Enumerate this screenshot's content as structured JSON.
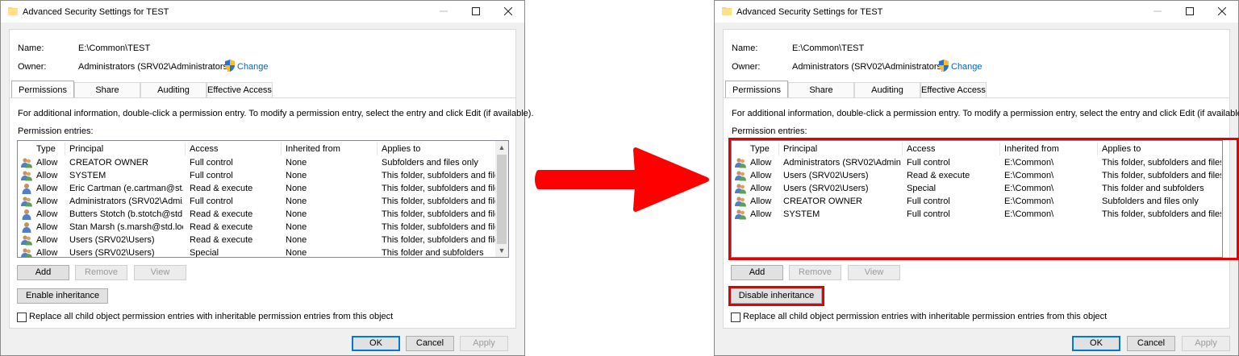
{
  "left": {
    "title": "Advanced Security Settings for TEST",
    "name_label": "Name:",
    "name_value": "E:\\Common\\TEST",
    "owner_label": "Owner:",
    "owner_value": "Administrators (SRV02\\Administrators)",
    "change_link": "Change",
    "tabs": [
      "Permissions",
      "Share",
      "Auditing",
      "Effective Access"
    ],
    "info": "For additional information, double-click a permission entry. To modify a permission entry, select the entry and click Edit (if available).",
    "entries_label": "Permission entries:",
    "columns": [
      "Type",
      "Principal",
      "Access",
      "Inherited from",
      "Applies to"
    ],
    "rows": [
      {
        "icon": "group-icon",
        "type": "Allow",
        "principal": "CREATOR OWNER",
        "access": "Full control",
        "inherited": "None",
        "applies": "Subfolders and files only"
      },
      {
        "icon": "group-icon",
        "type": "Allow",
        "principal": "SYSTEM",
        "access": "Full control",
        "inherited": "None",
        "applies": "This folder, subfolders and files"
      },
      {
        "icon": "user-icon",
        "type": "Allow",
        "principal": "Eric Cartman (e.cartman@st...",
        "access": "Read & execute",
        "inherited": "None",
        "applies": "This folder, subfolders and files"
      },
      {
        "icon": "group-icon",
        "type": "Allow",
        "principal": "Administrators (SRV02\\Admi...",
        "access": "Full control",
        "inherited": "None",
        "applies": "This folder, subfolders and files"
      },
      {
        "icon": "user-icon",
        "type": "Allow",
        "principal": "Butters Stotch (b.stotch@std....",
        "access": "Read & execute",
        "inherited": "None",
        "applies": "This folder, subfolders and files"
      },
      {
        "icon": "user-icon",
        "type": "Allow",
        "principal": "Stan Marsh (s.marsh@std.loc...",
        "access": "Read & execute",
        "inherited": "None",
        "applies": "This folder, subfolders and files"
      },
      {
        "icon": "group-icon",
        "type": "Allow",
        "principal": "Users (SRV02\\Users)",
        "access": "Read & execute",
        "inherited": "None",
        "applies": "This folder, subfolders and files"
      },
      {
        "icon": "group-icon",
        "type": "Allow",
        "principal": "Users (SRV02\\Users)",
        "access": "Special",
        "inherited": "None",
        "applies": "This folder and subfolders"
      }
    ],
    "btn_add": "Add",
    "btn_remove": "Remove",
    "btn_view": "View",
    "btn_inheritance": "Enable inheritance",
    "replace_label": "Replace all child object permission entries with inheritable permission entries from this object",
    "btn_ok": "OK",
    "btn_cancel": "Cancel",
    "btn_apply": "Apply"
  },
  "right": {
    "title": "Advanced Security Settings for TEST",
    "name_label": "Name:",
    "name_value": "E:\\Common\\TEST",
    "owner_label": "Owner:",
    "owner_value": "Administrators (SRV02\\Administrators)",
    "change_link": "Change",
    "tabs": [
      "Permissions",
      "Share",
      "Auditing",
      "Effective Access"
    ],
    "info": "For additional information, double-click a permission entry. To modify a permission entry, select the entry and click Edit (if available).",
    "entries_label": "Permission entries:",
    "columns": [
      "Type",
      "Principal",
      "Access",
      "Inherited from",
      "Applies to"
    ],
    "rows": [
      {
        "icon": "group-icon",
        "type": "Allow",
        "principal": "Administrators (SRV02\\Admin...",
        "access": "Full control",
        "inherited": "E:\\Common\\",
        "applies": "This folder, subfolders and files"
      },
      {
        "icon": "group-icon",
        "type": "Allow",
        "principal": "Users (SRV02\\Users)",
        "access": "Read & execute",
        "inherited": "E:\\Common\\",
        "applies": "This folder, subfolders and files"
      },
      {
        "icon": "group-icon",
        "type": "Allow",
        "principal": "Users (SRV02\\Users)",
        "access": "Special",
        "inherited": "E:\\Common\\",
        "applies": "This folder and subfolders"
      },
      {
        "icon": "group-icon",
        "type": "Allow",
        "principal": "CREATOR OWNER",
        "access": "Full control",
        "inherited": "E:\\Common\\",
        "applies": "Subfolders and files only"
      },
      {
        "icon": "group-icon",
        "type": "Allow",
        "principal": "SYSTEM",
        "access": "Full control",
        "inherited": "E:\\Common\\",
        "applies": "This folder, subfolders and files"
      }
    ],
    "btn_add": "Add",
    "btn_remove": "Remove",
    "btn_view": "View",
    "btn_inheritance": "Disable inheritance",
    "replace_label": "Replace all child object permission entries with inheritable permission entries from this object",
    "btn_ok": "OK",
    "btn_cancel": "Cancel",
    "btn_apply": "Apply"
  },
  "colors": {
    "highlight": "#e60000",
    "arrow": "#ff0000",
    "link": "#0066cc",
    "ok_border": "#0078d7"
  }
}
